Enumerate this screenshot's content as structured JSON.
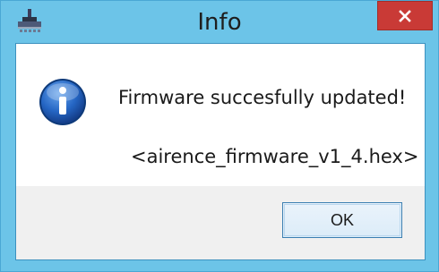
{
  "window": {
    "title": "Info",
    "icons": {
      "app": "app-logo-icon",
      "close": "close-icon",
      "info": "information-icon"
    }
  },
  "message": {
    "line1": "Firmware succesfully updated!",
    "line2": "<airence_firmware_v1_4.hex>"
  },
  "buttons": {
    "ok_label": "OK"
  },
  "colors": {
    "frame": "#6cc4e8",
    "close_button": "#c93a36",
    "content_bg": "#ffffff",
    "footer_bg": "#f0f0f0",
    "info_blue": "#1f5fb8"
  }
}
